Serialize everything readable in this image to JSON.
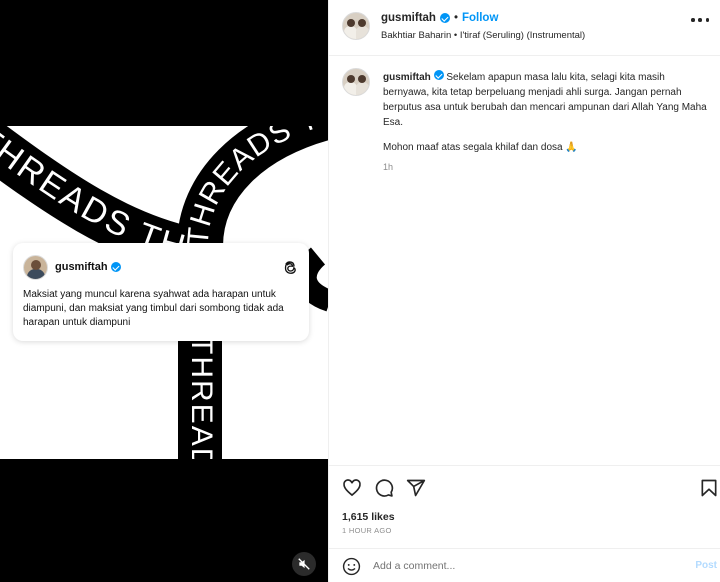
{
  "media": {
    "band_text": "THREADS THREADS THREADS THREADS THREADS THREADS",
    "threads_card": {
      "username": "gusmiftah",
      "text": "Maksiat yang muncul karena syahwat ada harapan untuk diampuni, dan maksiat yang timbul dari sombong tidak ada harapan untuk diampuni",
      "logo_icon": "threads-icon"
    },
    "mute_icon": "speaker-muted-icon"
  },
  "header": {
    "username": "gusmiftah",
    "separator": "•",
    "follow_label": "Follow",
    "audio": "Bakhtiar Baharin • I'tiraf (Seruling) (Instrumental)"
  },
  "caption": {
    "username": "gusmiftah",
    "text": "Sekelam apapun masa lalu kita, selagi kita masih bernyawa, kita tetap berpeluang menjadi ahli surga. Jangan pernah berputus asa untuk berubah dan mencari ampunan dari Allah Yang Maha Esa.",
    "line2": "Mohon maaf atas segala khilaf dan dosa 🙏",
    "time": "1h"
  },
  "actions": {
    "likes": "1,615 likes",
    "age": "1 HOUR AGO"
  },
  "comment": {
    "placeholder": "Add a comment...",
    "post_label": "Post"
  },
  "colors": {
    "accent": "#0095f6",
    "muted": "#8e8e8e",
    "border": "#efefef"
  }
}
